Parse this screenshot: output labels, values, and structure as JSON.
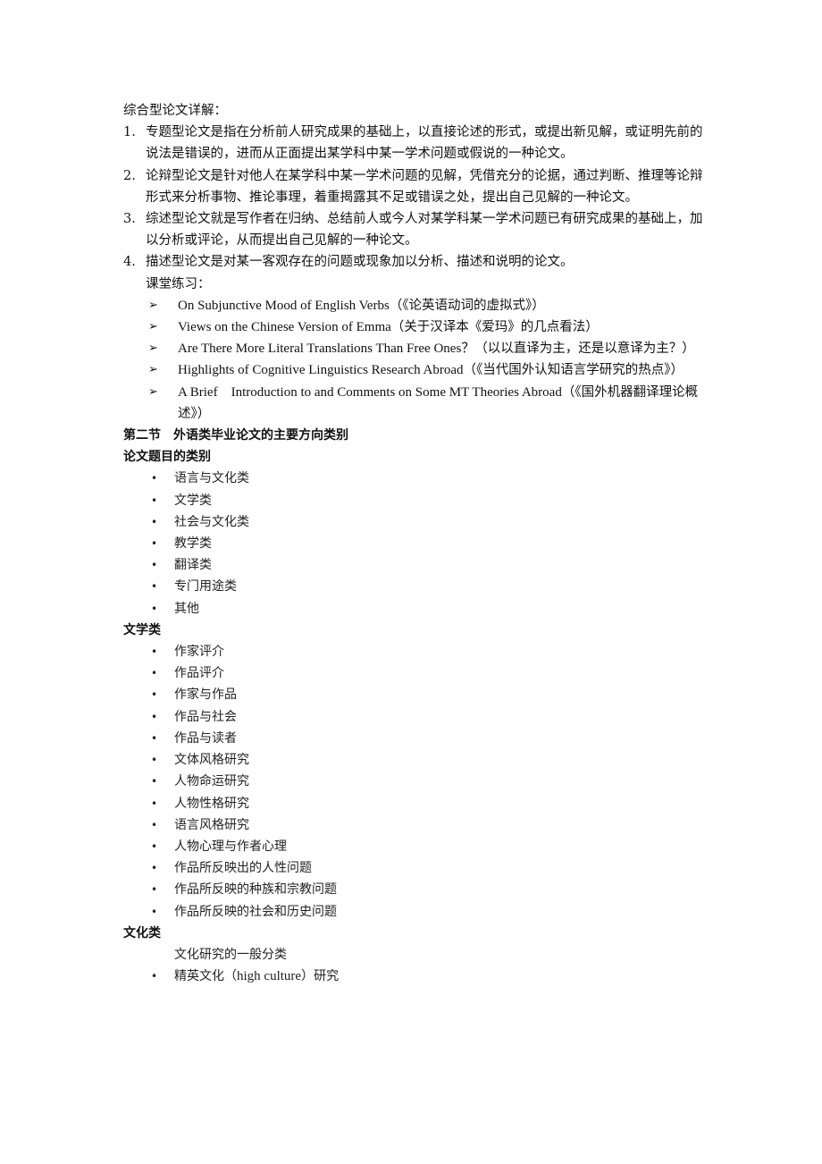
{
  "intro": {
    "heading": "综合型论文详解："
  },
  "types": [
    {
      "num": "1.",
      "text": "专题型论文是指在分析前人研究成果的基础上，以直接论述的形式，或提出新见解，或证明先前的说法是错误的，进而从正面提出某学科中某一学术问题或假说的一种论文。"
    },
    {
      "num": "2.",
      "text": "论辩型论文是针对他人在某学科中某一学术问题的见解，凭借充分的论据，通过判断、推理等论辩形式来分析事物、推论事理，着重揭露其不足或错误之处，提出自己见解的一种论文。"
    },
    {
      "num": "3.",
      "text": "综述型论文就是写作者在归纳、总结前人或今人对某学科某一学术问题已有研究成果的基础上，加以分析或评论，从而提出自己见解的一种论文。"
    },
    {
      "num": "4.",
      "text": "描述型论文是对某一客观存在的问题或现象加以分析、描述和说明的论文。"
    }
  ],
  "practice": {
    "label": "课堂练习：",
    "bullet_glyph": "➢",
    "items": [
      {
        "en": "On Subjunctive Mood of English Verbs",
        "zh": "（《论英语动词的虚拟式》）"
      },
      {
        "en": "Views on the Chinese Version of Emma",
        "zh": "（关于汉译本《爱玛》的几点看法）"
      },
      {
        "en": "Are There More Literal Translations Than Free Ones？",
        "zh": "（以以直译为主，还是以意译为主？）"
      },
      {
        "en": "Highlights of Cognitive Linguistics Research Abroad",
        "zh": "（《当代国外认知语言学研究的热点》）"
      },
      {
        "en": "A Brief    Introduction to and Comments on Some MT Theories Abroad",
        "zh": "（《国外机器翻译理论概述》）"
      }
    ]
  },
  "section2": {
    "title": "第二节　外语类毕业论文的主要方向类别",
    "categories_heading": "论文题目的类别",
    "categories": [
      "语言与文化类",
      "文学类",
      "社会与文化类",
      "教学类",
      "翻译类",
      "专门用途类",
      "其他"
    ],
    "literature_heading": "文学类",
    "literature_items": [
      "作家评介",
      "作品评介",
      "作家与作品",
      "作品与社会",
      "作品与读者",
      "文体风格研究",
      "人物命运研究",
      "人物性格研究",
      "语言风格研究",
      "人物心理与作者心理",
      "作品所反映出的人性问题",
      "作品所反映的种族和宗教问题",
      "作品所反映的社会和历史问题"
    ],
    "culture_heading": "文化类",
    "culture_sub_label": "文化研究的一般分类",
    "culture_items": [
      {
        "zh_before": "精英文化（",
        "en": "high culture",
        "zh_after": "）研究"
      }
    ]
  },
  "bullet_glyph": "•"
}
